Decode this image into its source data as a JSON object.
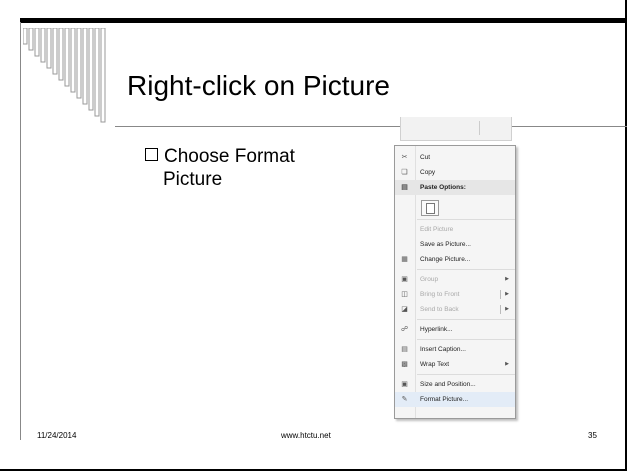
{
  "slide": {
    "title": "Right-click on Picture",
    "bullet_line1": "Choose Format",
    "bullet_line2": "Picture"
  },
  "footer": {
    "date": "11/24/2014",
    "url": "www.htctu.net",
    "page": "35"
  },
  "context_menu": {
    "items": [
      {
        "label": "Cut",
        "icon": "scissors-icon",
        "state": "enabled"
      },
      {
        "label": "Copy",
        "icon": "copy-icon",
        "state": "enabled"
      },
      {
        "label": "Paste Options:",
        "icon": "paste-icon",
        "state": "header"
      },
      {
        "label": "Edit Picture",
        "state": "disabled"
      },
      {
        "label": "Save as Picture...",
        "state": "enabled"
      },
      {
        "label": "Change Picture...",
        "icon": "change-picture-icon",
        "state": "enabled"
      },
      {
        "label": "Group",
        "icon": "group-icon",
        "state": "disabled",
        "submenu": true
      },
      {
        "label": "Bring to Front",
        "icon": "bring-front-icon",
        "state": "disabled",
        "submenu": true
      },
      {
        "label": "Send to Back",
        "icon": "send-back-icon",
        "state": "disabled",
        "submenu": true
      },
      {
        "label": "Hyperlink...",
        "icon": "hyperlink-icon",
        "state": "enabled"
      },
      {
        "label": "Insert Caption...",
        "icon": "caption-icon",
        "state": "enabled"
      },
      {
        "label": "Wrap Text",
        "icon": "wrap-text-icon",
        "state": "enabled",
        "submenu": true
      },
      {
        "label": "Size and Position...",
        "icon": "size-position-icon",
        "state": "enabled"
      },
      {
        "label": "Format Picture...",
        "icon": "format-picture-icon",
        "state": "selected"
      }
    ]
  }
}
